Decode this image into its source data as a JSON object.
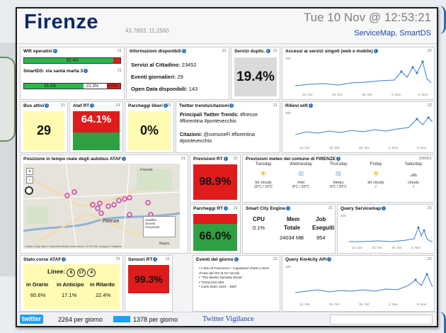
{
  "header": {
    "city": "Firenze",
    "coords": "43.7693, 11.2560",
    "datetime": "Tue 10 Nov @ 12:53:21",
    "brand": "ServiceMap, SmartDS"
  },
  "wifi": {
    "title": "Wifi operativi",
    "num": "21",
    "top_value": "92.4%",
    "bottom_title": "SmartDS: via santa marta 3",
    "bottom_num": "21",
    "segment_labels": [
      "15.1%",
      "21.3%",
      "0.0%"
    ],
    "top_fill_pct": 92.4,
    "bottom_segments_pct": [
      15.1,
      21.3,
      0
    ]
  },
  "info": {
    "title": "Informazioni disponibili",
    "num": "21",
    "line1_label": "Servizi al Cittadino:",
    "line1_value": "23452",
    "line2_label": "Eventi giornalieri:",
    "line2_value": "29",
    "line3_label": "Open Data disponibili:",
    "line3_value": "143"
  },
  "dup": {
    "title": "Servizi duplic.",
    "num": "21",
    "value": "19.4%"
  },
  "access": {
    "title": "Accessi ai servizi singoli (web e mobile)",
    "num": "22",
    "ylabel": "400",
    "xlabels": [
      "12. Oct",
      "19. Oct",
      "26. Oct",
      "2. Nov",
      "9. Nov"
    ]
  },
  "bus": {
    "title": "Bus attivi",
    "num": "21",
    "value": "29"
  },
  "atafrt": {
    "title": "Ataf RT",
    "num": "21",
    "value": "64.1%"
  },
  "parking_free": {
    "title": "Parcheggi liberi",
    "num": "21",
    "value": "0%"
  },
  "twitter": {
    "title": "Twitter trends/citazioni",
    "num": "21",
    "main_label": "Principali Twitter Trends:",
    "main_tags": "#firenze #florentina #pontevecchio",
    "cit_label": "Citazioni:",
    "cit_tags": "@comuneFi #florentina #pontevecchio"
  },
  "wifi_detect": {
    "title": "Rilievi wifi",
    "num": "22",
    "ylabel": "400",
    "xlabels": [
      "12. Oct",
      "19. Oct",
      "26. Oct",
      "2. Nov",
      "9. Nov"
    ]
  },
  "map": {
    "title": "Posizione in tempo reale degli autobus ATAF",
    "num": "21",
    "zoom_in": "+",
    "zoom_out": "-",
    "place1": "Firenze",
    "place2": "Fiesole",
    "place3": "Bagno",
    "legend": [
      "Satellite",
      "Streets",
      "Grayscale"
    ],
    "attribution": "Leaflet | Map data © OpenStreetMap contributors, CC-BY-SA, Imagery © Mapbox"
  },
  "prev_rt": {
    "title": "Previsioni RT",
    "num": "21",
    "value": "98.9%"
  },
  "meteo": {
    "title": "Previsioni meteo del comune di FIRENZE",
    "num": "29/06/1",
    "days": [
      {
        "day": "Tuesday",
        "cond": "bit cloudy",
        "temp": "15°C / 10°C"
      },
      {
        "day": "Wednesday",
        "cond": "mist",
        "temp": "8°C / 20°C"
      },
      {
        "day": "Thursday",
        "cond": "bleary",
        "temp": "8°C / 20°C"
      },
      {
        "day": "Friday",
        "cond": "bit cloudy",
        "temp": "/"
      },
      {
        "day": "Saturday",
        "cond": "cloudy",
        "temp": "/"
      }
    ],
    "icons": [
      "sun-cloud-icon",
      "fog-icon",
      "fog-icon",
      "sun-cloud-icon",
      "cloud-icon"
    ]
  },
  "park_rt": {
    "title": "Parcheggi RT",
    "num": "21",
    "value": "66.0%"
  },
  "engine": {
    "title": "Smart City Engine",
    "num": "21",
    "h_cpu": "CPU",
    "h_mem": "Mem",
    "h_job": "Job",
    "h_mem2": "Totale",
    "h_job2": "Eseguiti",
    "cpu": "0.1%",
    "mem": "24034 MB",
    "job": "954"
  },
  "servicemap": {
    "title": "Query Servicemap",
    "num": "21",
    "ylabel": "400",
    "xlabels": [
      "12. Oct",
      "19. Oct",
      "26. Oct",
      "2. Nov"
    ]
  },
  "stato": {
    "title": "Stato corse ATAF",
    "num": "21",
    "lines_label": "Linee:",
    "lines": [
      "6",
      "17",
      "4"
    ],
    "h1": "in Orario",
    "h2": "in Anticipo",
    "h3": "in Ritardo",
    "v1": "60.6%",
    "v2": "17.1%",
    "v3": "22.4%"
  },
  "sensori": {
    "title": "Sensori RT",
    "num": "21",
    "value": "99.3%"
  },
  "eventi": {
    "title": "Eventi del giorno",
    "num": "21",
    "items": [
      "L'arte di Francesco - Capolavori d'arte e terre d'Asia dal XIII al XV secolo",
      "\"The Medici Dynasty Show\"",
      "TOSCANA 900",
      "Carlo Dolci 1616 - 1687"
    ]
  },
  "km4city": {
    "title": "Query Km4city API",
    "num": "22",
    "ylabel": "400",
    "xlabels": [
      "12. Oct",
      "19. Oct",
      "26. Oct",
      "2. Nov",
      "9. Nov"
    ]
  },
  "footer": {
    "twitter": "twitter",
    "per_day1": "2264 per giorno",
    "per_day2": "1378 per giorno",
    "vigilance": "Twitter Vigilance"
  },
  "colors": {
    "red": "#e01b1b",
    "green": "#2fa043",
    "yellow": "#fffbb3",
    "gray": "#d9dadb",
    "navy": "#0e2a6b",
    "blue": "#1a43a8"
  }
}
